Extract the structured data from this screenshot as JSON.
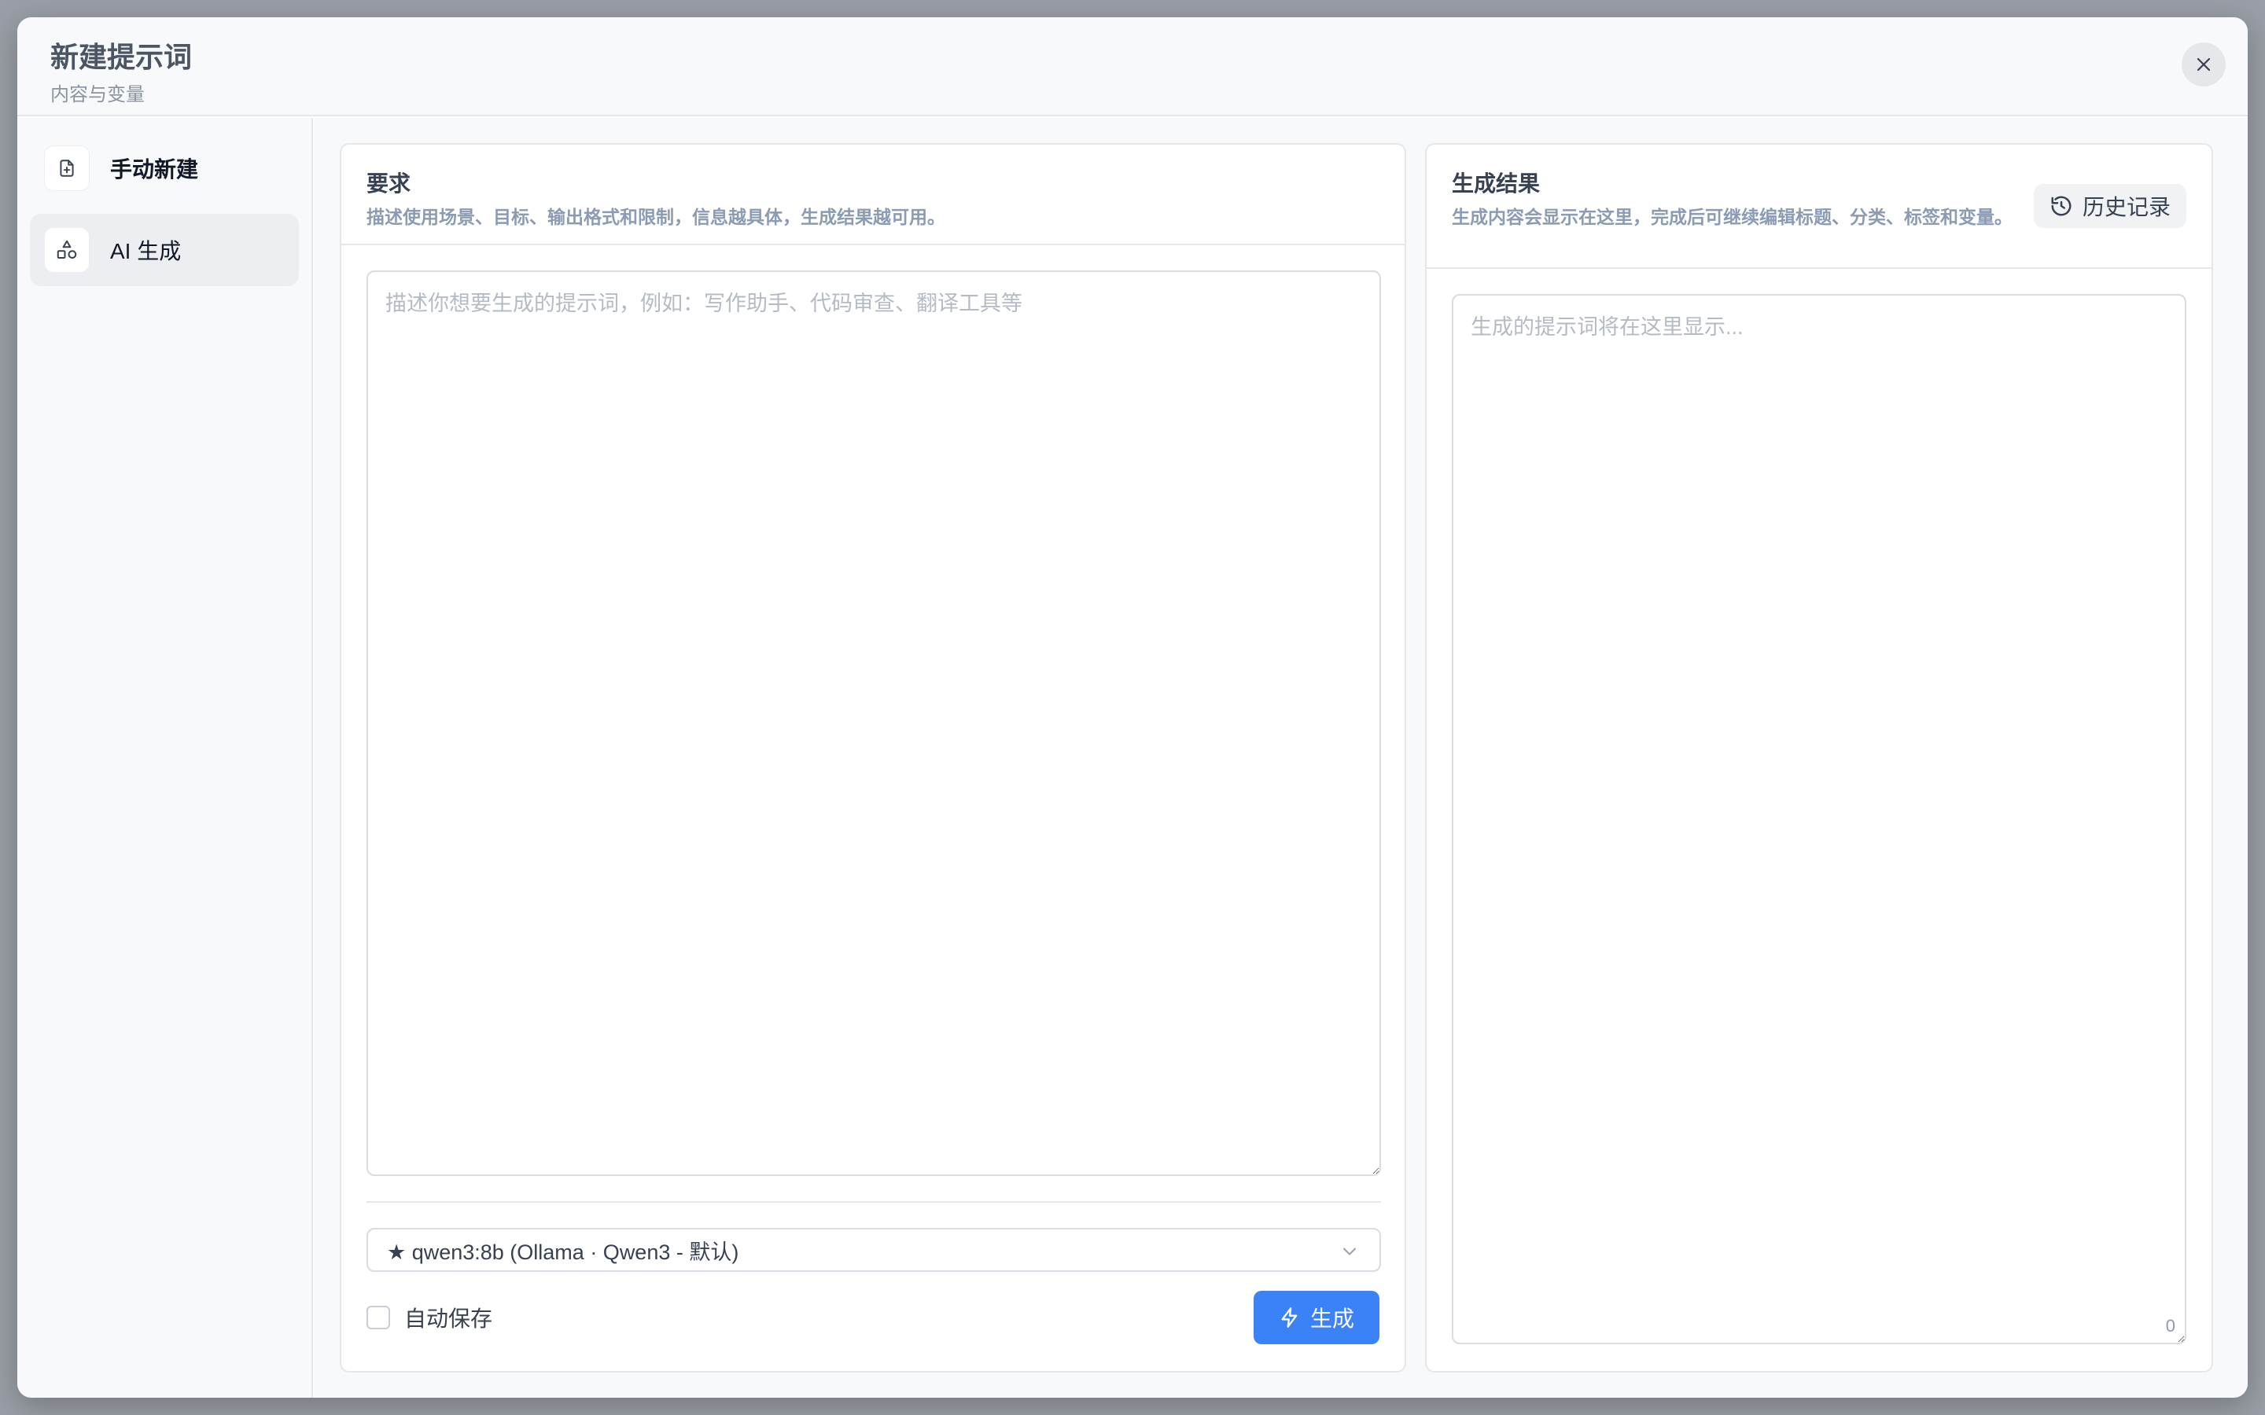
{
  "modal": {
    "title": "新建提示词",
    "subtitle": "内容与变量"
  },
  "sidebar": {
    "items": [
      {
        "label": "手动新建",
        "icon": "file-plus-icon",
        "active": false
      },
      {
        "label": "AI 生成",
        "icon": "shapes-icon",
        "active": true
      }
    ]
  },
  "requirements": {
    "title": "要求",
    "description": "描述使用场景、目标、输出格式和限制，信息越具体，生成结果越可用。",
    "placeholder": "描述你想要生成的提示词，例如：写作助手、代码审查、翻译工具等",
    "value": ""
  },
  "model": {
    "selected": "★ qwen3:8b (Ollama · Qwen3 - 默认)"
  },
  "autosave": {
    "label": "自动保存",
    "checked": false
  },
  "generate": {
    "label": "生成"
  },
  "result": {
    "title": "生成结果",
    "description": "生成内容会显示在这里，完成后可继续编辑标题、分类、标签和变量。",
    "history_label": "历史记录",
    "placeholder": "生成的提示词将在这里显示...",
    "value": "",
    "char_count": "0"
  },
  "colors": {
    "accent": "#3b82f6",
    "active_bg": "#eceef2"
  }
}
